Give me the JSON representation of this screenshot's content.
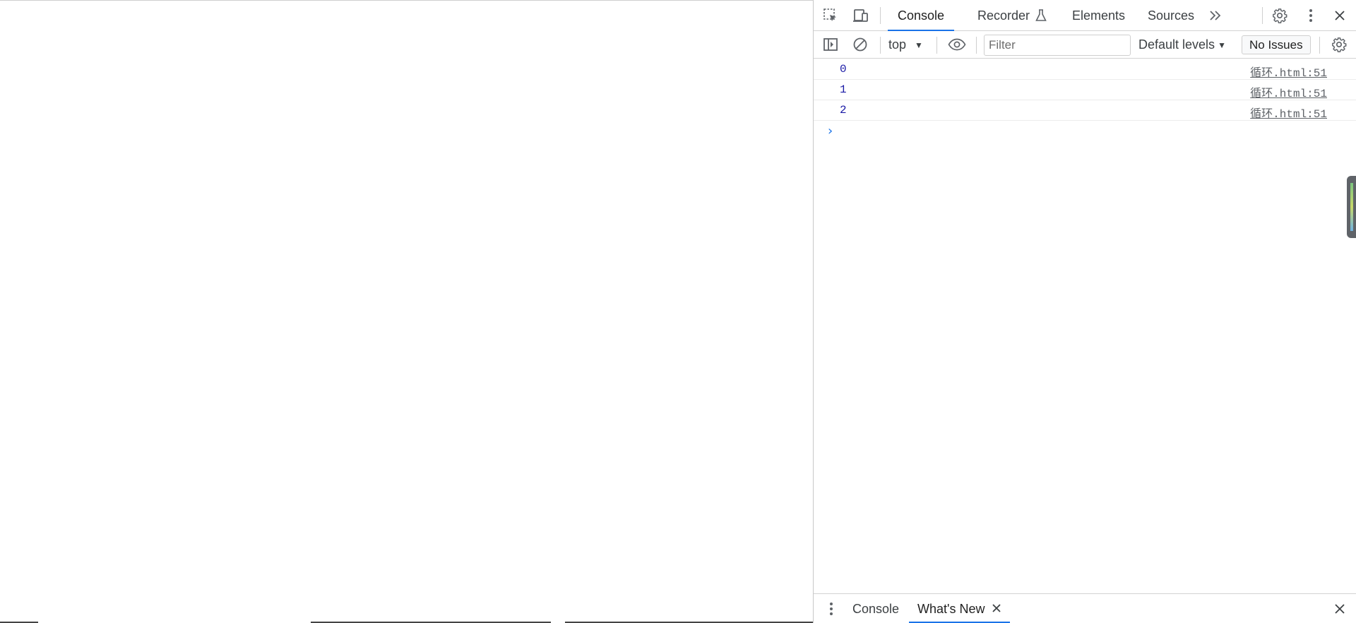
{
  "devtools": {
    "tabs": [
      {
        "label": "Console",
        "active": true
      },
      {
        "label": "Recorder",
        "active": false
      },
      {
        "label": "Elements",
        "active": false
      },
      {
        "label": "Sources",
        "active": false
      }
    ],
    "icons": {
      "inspect": "inspect-element-icon",
      "device": "device-toolbar-icon",
      "recorder_flask": "flask-icon",
      "more_tabs": "chevron-double-right-icon",
      "settings": "gear-icon",
      "menu": "kebab-menu-icon",
      "close": "close-icon"
    },
    "accent_color": "#1a73e8"
  },
  "console_toolbar": {
    "context": "top",
    "filter_placeholder": "Filter",
    "levels": "Default levels",
    "issues": "No Issues"
  },
  "messages": [
    {
      "value": "0",
      "source": "循环.html:51"
    },
    {
      "value": "1",
      "source": "循环.html:51"
    },
    {
      "value": "2",
      "source": "循环.html:51"
    }
  ],
  "drawer": {
    "tabs": [
      {
        "label": "Console",
        "active": false
      },
      {
        "label": "What's New",
        "active": true,
        "closable": true
      }
    ]
  }
}
